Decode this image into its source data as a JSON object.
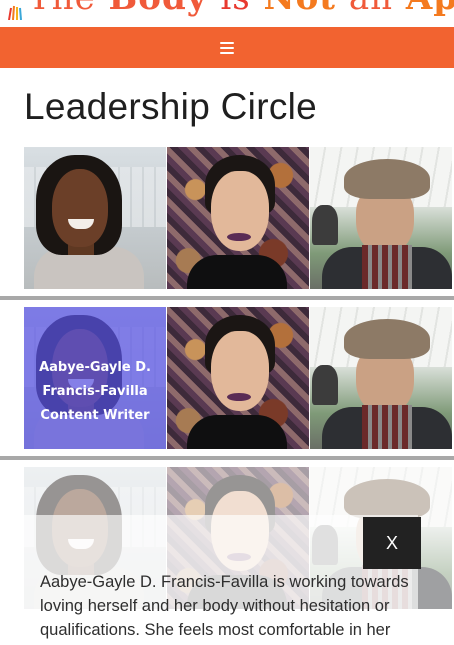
{
  "header": {
    "logo_words": [
      "The",
      "Body",
      "is",
      "Not",
      "an",
      "Apology"
    ]
  },
  "navbar": {
    "menu_icon": "hamburger-menu-icon",
    "color": "#f26330"
  },
  "main": {
    "title": "Leadership Circle",
    "members": [
      {
        "name_line1": "Aabye-Gayle D.",
        "name_line2": "Francis-Favilla",
        "role": "Content Writer"
      }
    ]
  },
  "modal": {
    "close_label": "X",
    "bio_text": "Aabye-Gayle D. Francis-Favilla is working towards loving herself and her body without hesitation or qualifications. She feels most comfortable in her"
  },
  "colors": {
    "overlay": "#5a55e6",
    "divider": "#a8a8a8"
  }
}
